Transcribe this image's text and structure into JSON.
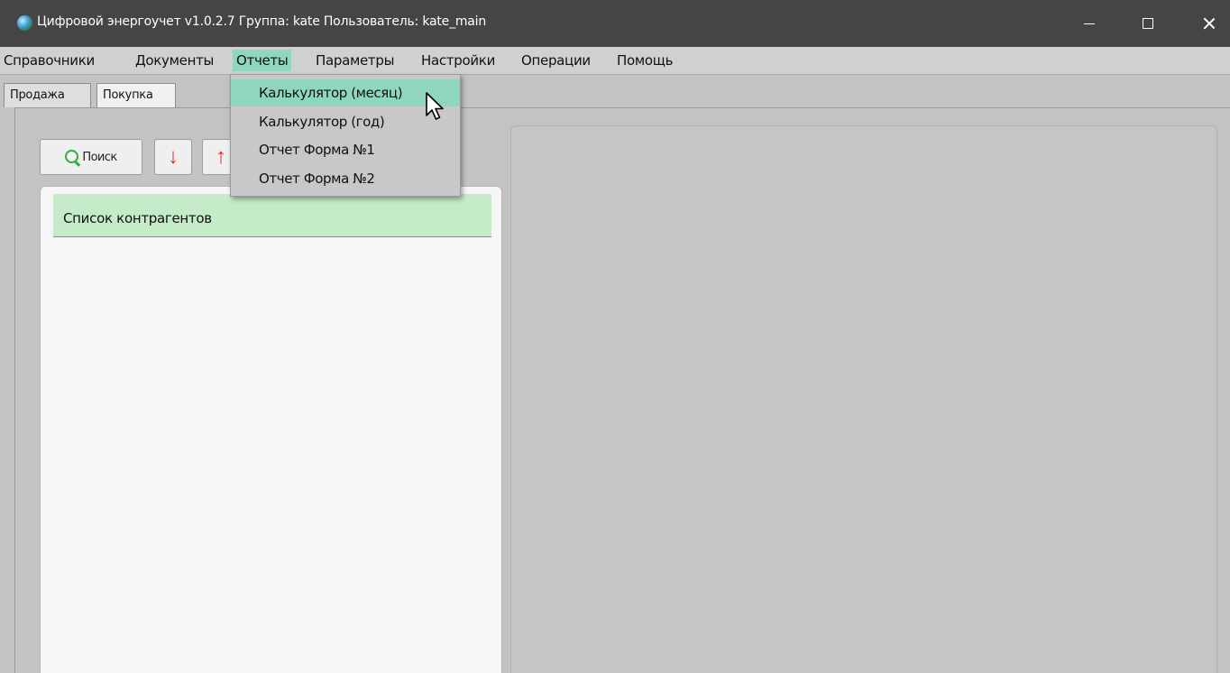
{
  "window": {
    "title": "Цифровой энергоучет v1.0.2.7 Группа: kate Пользователь: kate_main",
    "icon": "globe-icon"
  },
  "menubar": {
    "items": [
      {
        "label": "Справочники"
      },
      {
        "label": "Документы"
      },
      {
        "label": "Отчеты",
        "active": true
      },
      {
        "label": "Параметры"
      },
      {
        "label": "Настройки"
      },
      {
        "label": "Операции"
      },
      {
        "label": "Помощь"
      }
    ]
  },
  "reports_menu": {
    "items": [
      {
        "label": "Калькулятор (месяц)",
        "highlighted": true
      },
      {
        "label": "Калькулятор (год)"
      },
      {
        "label": "Отчет Форма №1"
      },
      {
        "label": "Отчет Форма №2"
      }
    ]
  },
  "tabs": [
    {
      "label": "Продажа",
      "selected": false
    },
    {
      "label": "Покупка",
      "selected": true
    }
  ],
  "toolbar": {
    "search_label": "Поиск",
    "search_icon": "search-icon",
    "down_arrow": "↓",
    "up_arrow": "↑"
  },
  "list_panel": {
    "header": "Список контрагентов"
  },
  "colors": {
    "titlebar": "#454545",
    "menu_highlight": "#8fd6be",
    "list_header": "#c5ebc9",
    "arrow_red": "#e0312b",
    "search_green": "#2fae3d"
  }
}
